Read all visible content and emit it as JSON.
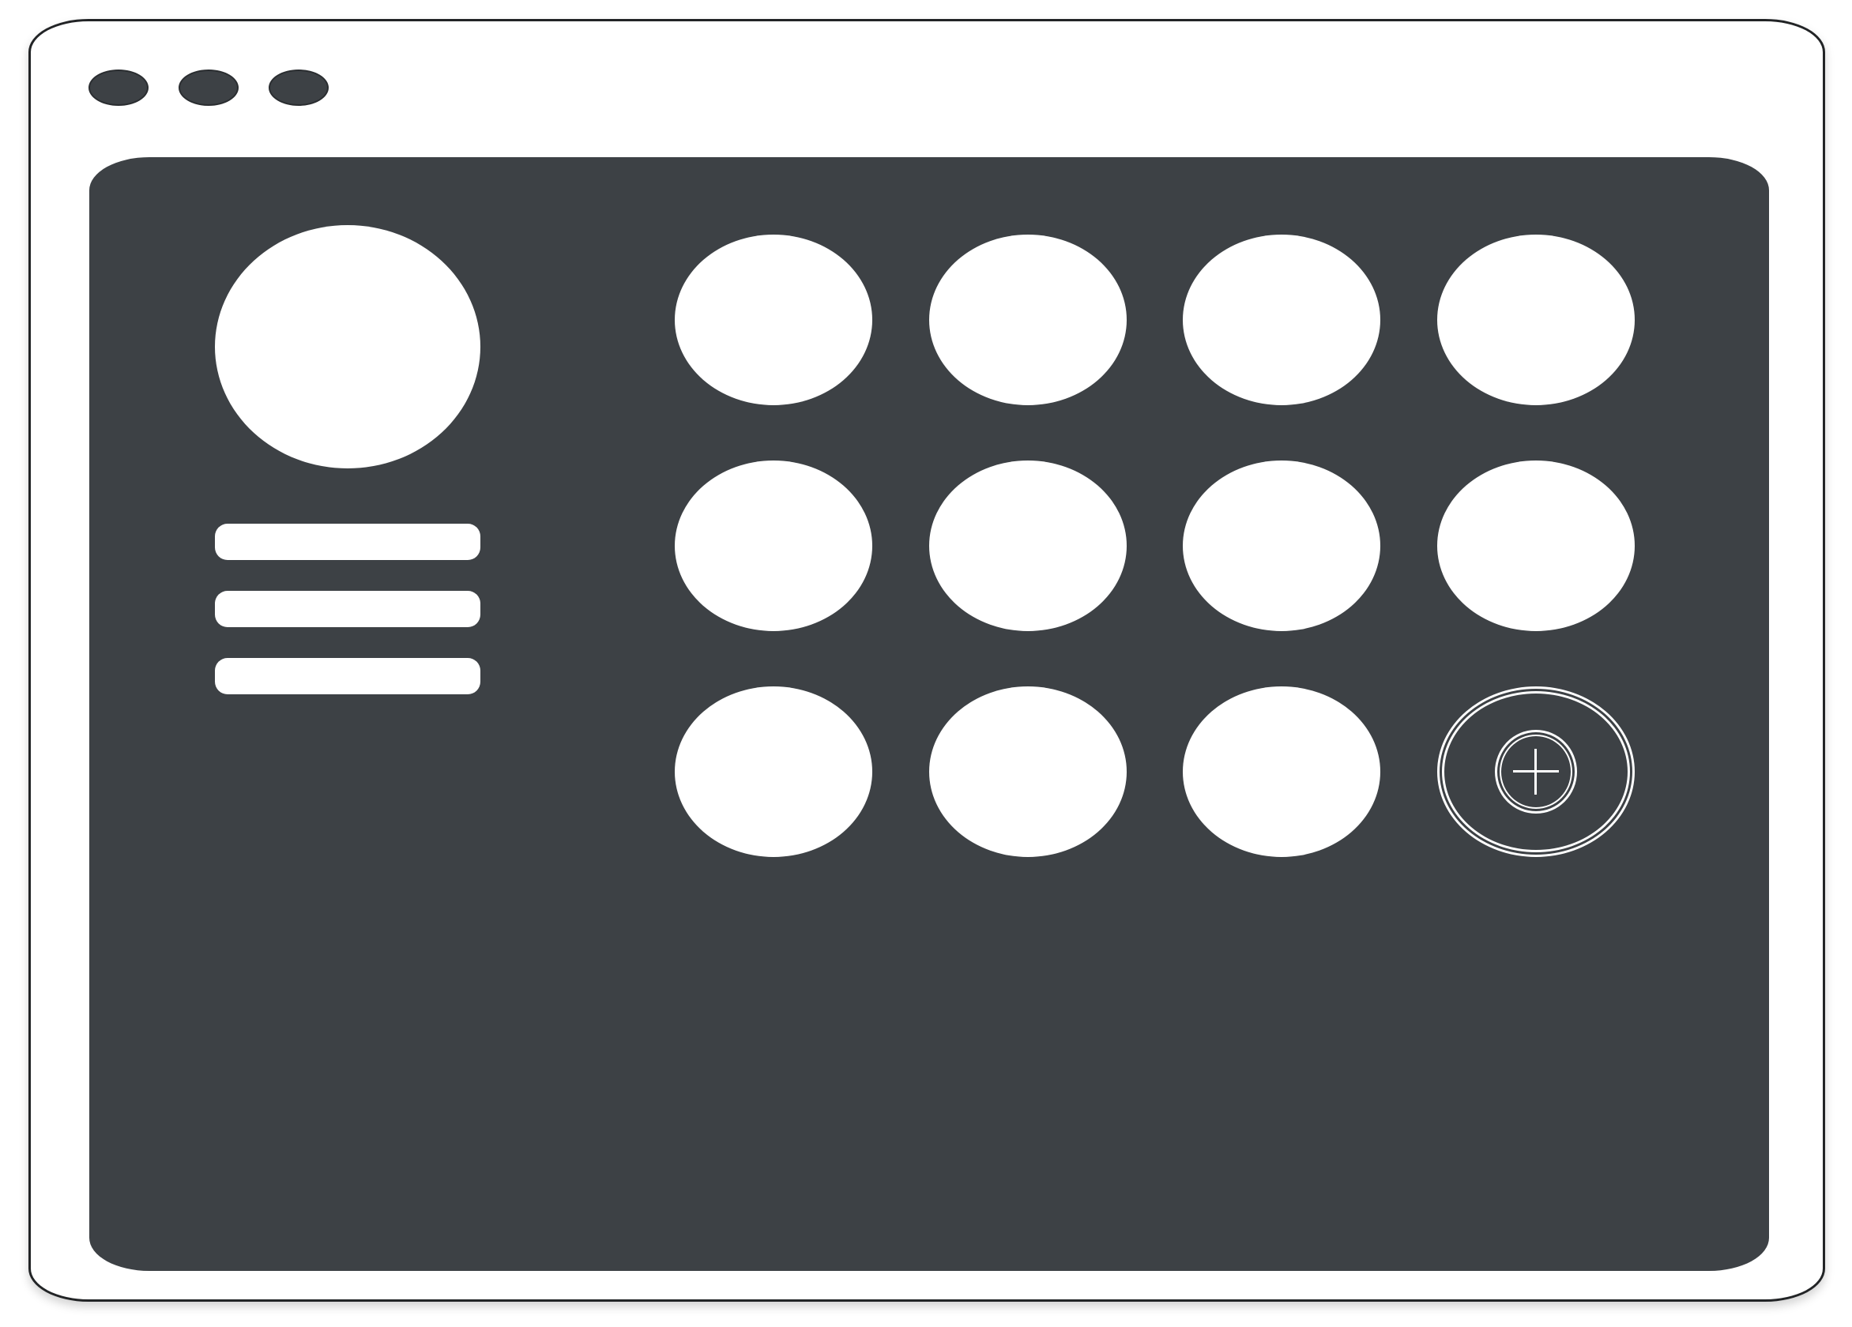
{
  "window": {
    "controls": [
      "window-control-1",
      "window-control-2",
      "window-control-3"
    ]
  },
  "profile": {
    "avatar": "avatar",
    "menu_items": [
      "menu-item-1",
      "menu-item-2",
      "menu-item-3"
    ]
  },
  "grid": {
    "tiles": 11,
    "add_tile_icon": "plus-icon"
  },
  "colors": {
    "panel": "#3d4145",
    "foreground": "#ffffff",
    "frame": "#222426"
  }
}
